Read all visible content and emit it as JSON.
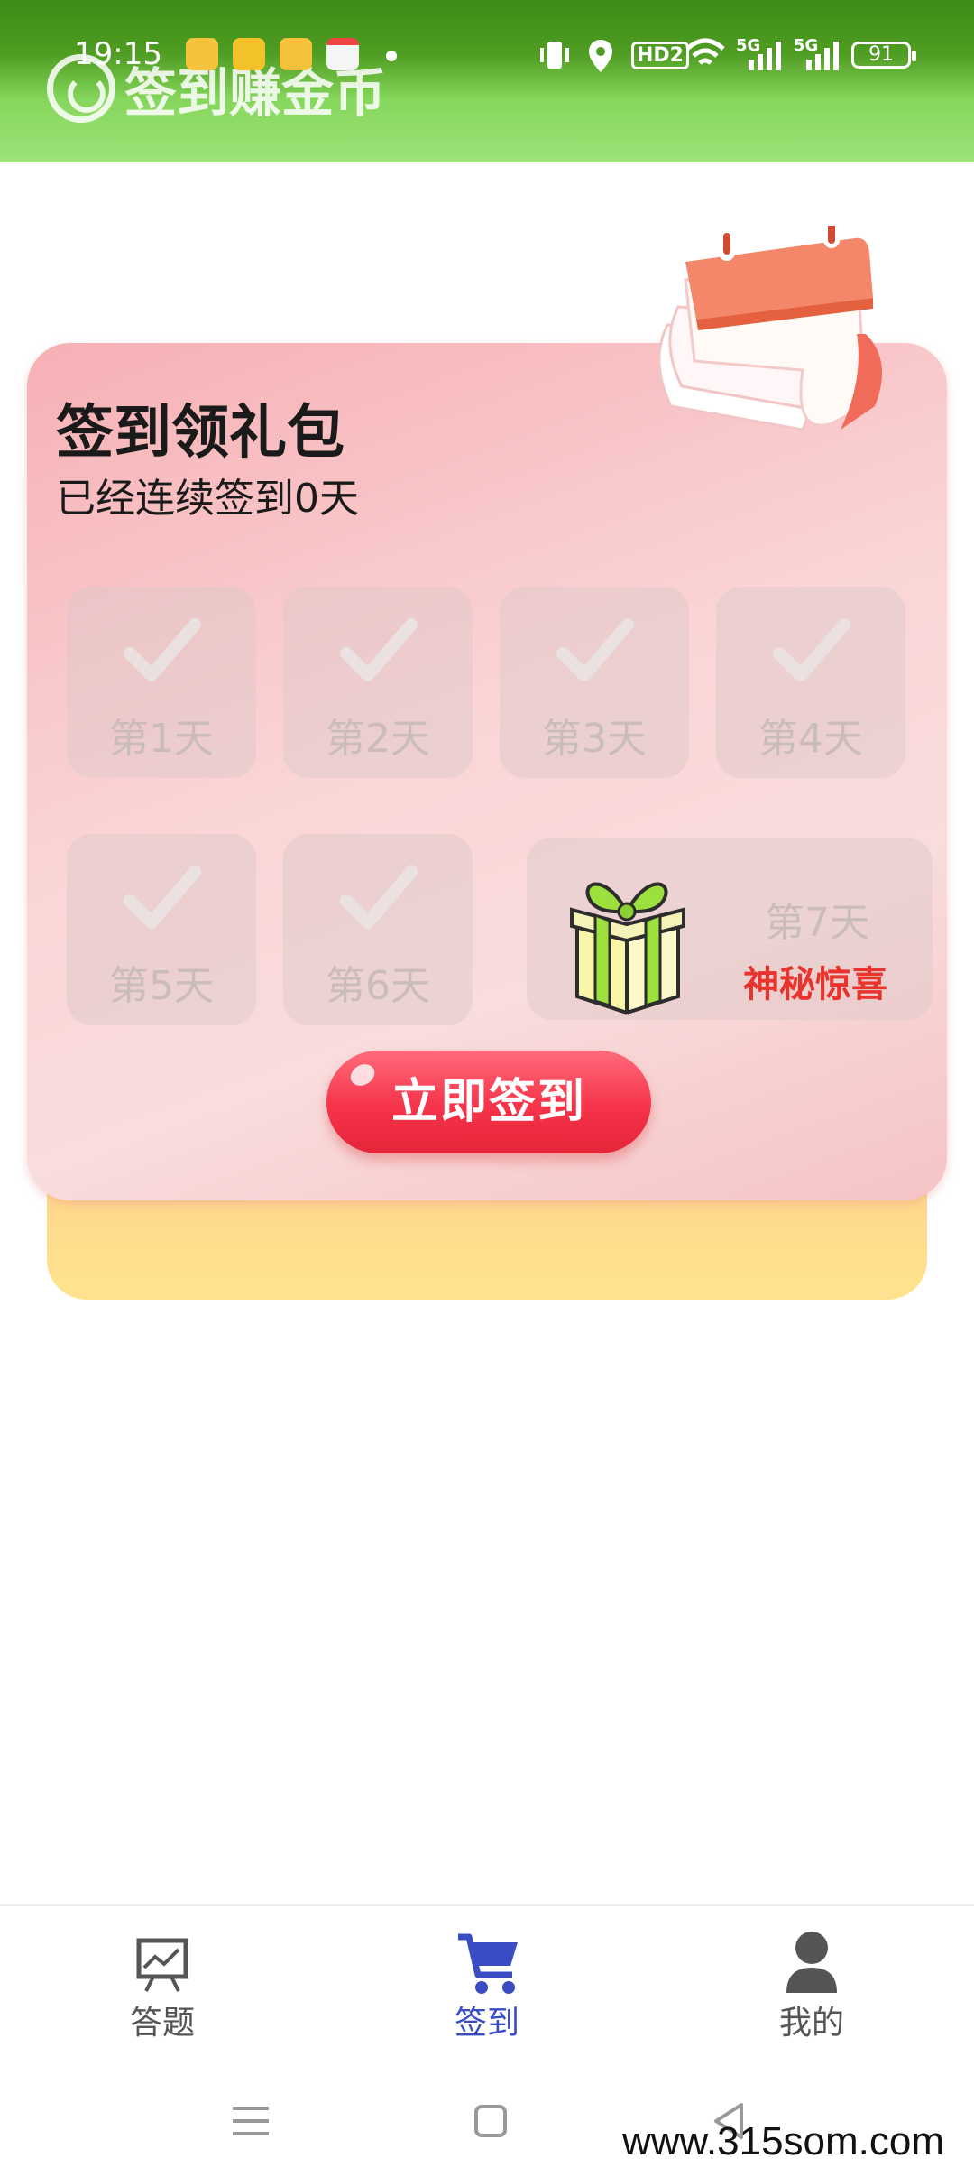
{
  "status_bar": {
    "time": "19:15",
    "signal_label_1": "5G",
    "signal_label_2": "5G",
    "hd_label": "HD2",
    "battery": "91"
  },
  "header": {
    "title": "签到赚金币",
    "logo_icon": "refresh-circle-icon"
  },
  "card": {
    "title": "签到领礼包",
    "subtitle": "已经连续签到0天",
    "days": [
      {
        "label": "第1天",
        "icon": "check-icon"
      },
      {
        "label": "第2天",
        "icon": "check-icon"
      },
      {
        "label": "第3天",
        "icon": "check-icon"
      },
      {
        "label": "第4天",
        "icon": "check-icon"
      },
      {
        "label": "第5天",
        "icon": "check-icon"
      },
      {
        "label": "第6天",
        "icon": "check-icon"
      }
    ],
    "day7": {
      "label": "第7天",
      "reward": "神秘惊喜",
      "icon": "gift-icon"
    },
    "button_label": "立即签到"
  },
  "bottom_nav": {
    "items": [
      {
        "label": "答题",
        "icon": "chart-board-icon",
        "active": false
      },
      {
        "label": "签到",
        "icon": "shopping-cart-icon",
        "active": true
      },
      {
        "label": "我的",
        "icon": "user-icon",
        "active": false
      }
    ]
  },
  "watermark": "www.315som.com",
  "colors": {
    "header_green": "#4f9d22",
    "accent_red": "#f5334a",
    "active_nav": "#3a4cc4",
    "surprise_text": "#e8342d"
  }
}
